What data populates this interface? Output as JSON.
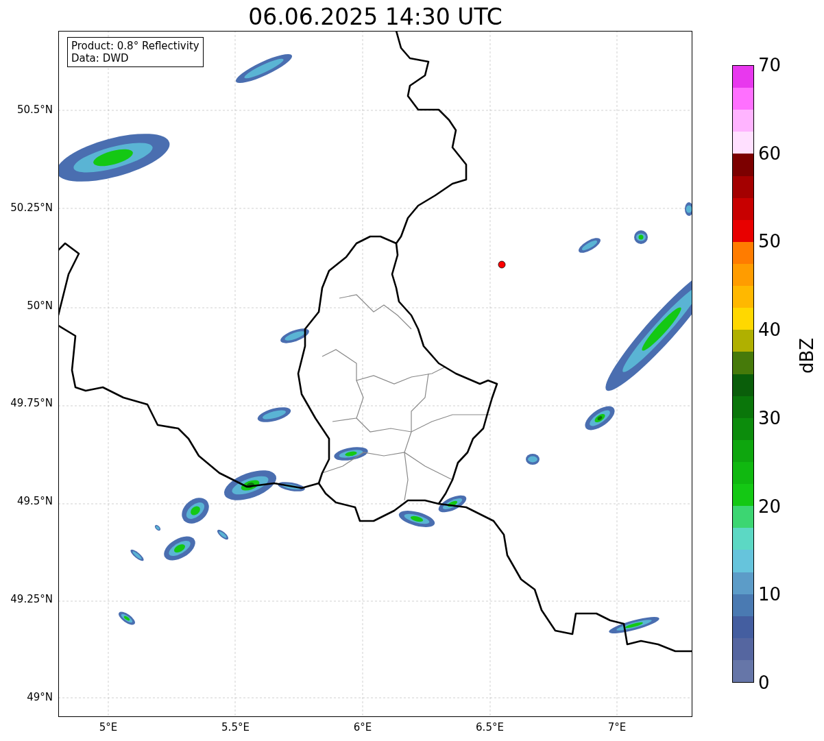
{
  "title": "06.06.2025 14:30 UTC",
  "legend": [
    "Product: 0.8° Reflectivity",
    "Data: DWD"
  ],
  "y_ticks": [
    "50.5°N",
    "50.25°N",
    "50°N",
    "49.75°N",
    "49.5°N",
    "49.25°N",
    "49°N"
  ],
  "x_ticks": [
    "5°E",
    "5.5°E",
    "6°E",
    "6.5°E",
    "7°E"
  ],
  "colorbar": {
    "label": "dBZ",
    "ticks": [
      "70",
      "60",
      "50",
      "40",
      "30",
      "20",
      "10",
      "0"
    ],
    "bands": [
      {
        "color": "#e838ee"
      },
      {
        "color": "#ff70ff"
      },
      {
        "color": "#ffb4ff"
      },
      {
        "color": "#ffe0ff"
      },
      {
        "color": "#7c0000"
      },
      {
        "color": "#a40000"
      },
      {
        "color": "#c80000"
      },
      {
        "color": "#e80000"
      },
      {
        "color": "#ff7c00"
      },
      {
        "color": "#ff9c00"
      },
      {
        "color": "#ffb800"
      },
      {
        "color": "#ffd800"
      },
      {
        "color": "#b0b000"
      },
      {
        "color": "#467a0a"
      },
      {
        "color": "#0a5e0a"
      },
      {
        "color": "#0a760a"
      },
      {
        "color": "#0c8c0c"
      },
      {
        "color": "#0ea60e"
      },
      {
        "color": "#10b810"
      },
      {
        "color": "#14c814"
      },
      {
        "color": "#3cd672"
      },
      {
        "color": "#5cd8c4"
      },
      {
        "color": "#66c4dc"
      },
      {
        "color": "#5c9cc8"
      },
      {
        "color": "#4a7ab2"
      },
      {
        "color": "#445ea0"
      },
      {
        "color": "#5566a0"
      },
      {
        "color": "#6676a8"
      }
    ]
  }
}
